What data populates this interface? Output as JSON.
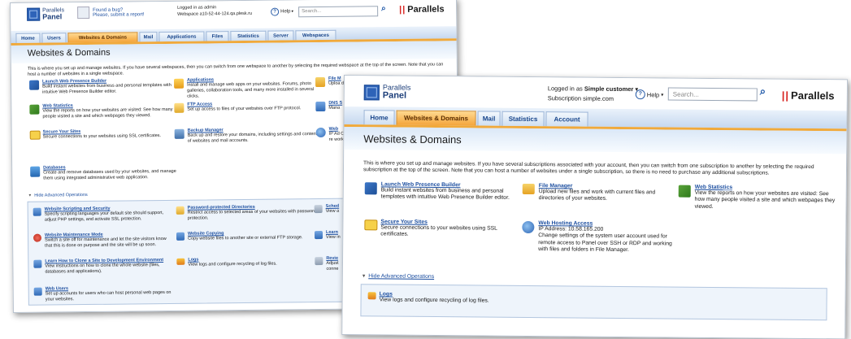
{
  "back": {
    "logo": {
      "line1": "Parallels",
      "line2": "Panel"
    },
    "bug_link": {
      "line1": "Found a bug?",
      "line2": "Please, submit a report!"
    },
    "support": {
      "line1": "Logged in as admin",
      "line2": "Webspace a10-52-44-124.qa.plesk.ru"
    },
    "help_label": "Help",
    "search_placeholder": "Search...",
    "brand": "Parallels",
    "tabs": [
      "Home",
      "Users",
      "Websites & Domains",
      "Mail",
      "Applications",
      "Files",
      "Statistics",
      "Server",
      "Webspaces"
    ],
    "page_title": "Websites & Domains",
    "intro": "This is where you set up and manage websites. If you have several webspaces, then you can switch from one webspace to another by selecting the required webspace at the top of the screen. Note that you can host a number of websites in a single webspace.",
    "items": [
      {
        "title": "Launch Web Presence Builder",
        "desc": "Build instant websites from business and personal templates with intuitive Web Presence Builder editor."
      },
      {
        "title": "Applications",
        "desc": "Install and manage web apps on your websites. Forums, photo galleries, collaboration tools, and many more installed in several clicks."
      },
      {
        "title": "File M",
        "desc": "Uploa direc"
      },
      {
        "title": "Web Statistics",
        "desc": "View the reports on how your websites are visited: See how many people visited a site and which webpages they viewed."
      },
      {
        "title": "FTP Access",
        "desc": "Set up access to files of your websites over FTP protocol."
      },
      {
        "title": "DNS S",
        "desc": "Mana"
      },
      {
        "title": "Secure Your Sites",
        "desc": "Secure connections to your websites using SSL certificates."
      },
      {
        "title": "Backup Manager",
        "desc": "Back up and restore your domains, including settings and content of websites and mail accounts."
      },
      {
        "title": "Web",
        "desc": "IP Ad Chang for re work"
      },
      {
        "title": "Databases",
        "desc": "Create and remove databases used by your websites, and manage them using integrated administrative web application."
      }
    ],
    "adv_label": "Hide Advanced Operations",
    "adv_items": [
      {
        "title": "Website Scripting and Security",
        "desc": "Specify scripting languages your default site should support, adjust PHP settings, and activate SSL protection."
      },
      {
        "title": "Password-protected Directories",
        "desc": "Restrict access to selected areas of your websites with password protection."
      },
      {
        "title": "Sched",
        "desc": "View a"
      },
      {
        "title": "Website Maintenance Mode",
        "desc": "Switch a site off for maintenance and let the site visitors know that this is done on purpose and the site will be up soon."
      },
      {
        "title": "Website Copying",
        "desc": "Copy website files to another site or external FTP storage."
      },
      {
        "title": "Learn",
        "desc": "View in"
      },
      {
        "title": "Learn How to Clone a Site to Development Environment",
        "desc": "View instructions on how to clone the whole website (files, databases and applications)."
      },
      {
        "title": "Logs",
        "desc": "View logs and configure recycling of log files."
      },
      {
        "title": "Revie",
        "desc": "Adjust conne"
      },
      {
        "title": "Web Users",
        "desc": "Set up accounts for users who can host personal web pages on your websites."
      }
    ]
  },
  "front": {
    "logo": {
      "line1": "Parallels",
      "line2": "Panel"
    },
    "login": {
      "prefix": "Logged in as",
      "user": "Simple customer",
      "line2": "Subscription simple.com"
    },
    "help_label": "Help",
    "search_placeholder": "Search...",
    "brand": "Parallels",
    "tabs": [
      "Home",
      "Websites & Domains",
      "Mail",
      "Statistics",
      "Account"
    ],
    "page_title": "Websites & Domains",
    "intro": "This is where you set up and manage websites. If you have several subscriptions associated with your account, then you can switch from one subscription to another by selecting the required subscription at the top of the screen. Note that you can host a number of websites under a single subscription, so there is no need to purchase any additional subscriptions.",
    "items": [
      {
        "title": "Launch Web Presence Builder",
        "desc": "Build instant websites from business and personal templates with intuitive Web Presence Builder editor."
      },
      {
        "title": "File Manager",
        "desc": "Upload new files and work with current files and directories of your websites."
      },
      {
        "title": "Web Statistics",
        "desc": "View the reports on how your websites are visited: See how many people visited a site and which webpages they viewed."
      },
      {
        "title": "Secure Your Sites",
        "desc": "Secure connections to your websites using SSL certificates."
      },
      {
        "title": "Web Hosting Access",
        "ip": "IP Address: 10.58.165.200",
        "desc": "Change settings of the system user account used for remote access to Panel over SSH or RDP and working with files and folders in File Manager."
      }
    ],
    "adv_label": "Hide Advanced Operations",
    "adv_items": [
      {
        "title": "Logs",
        "desc": "View logs and configure recycling of log files."
      }
    ]
  }
}
